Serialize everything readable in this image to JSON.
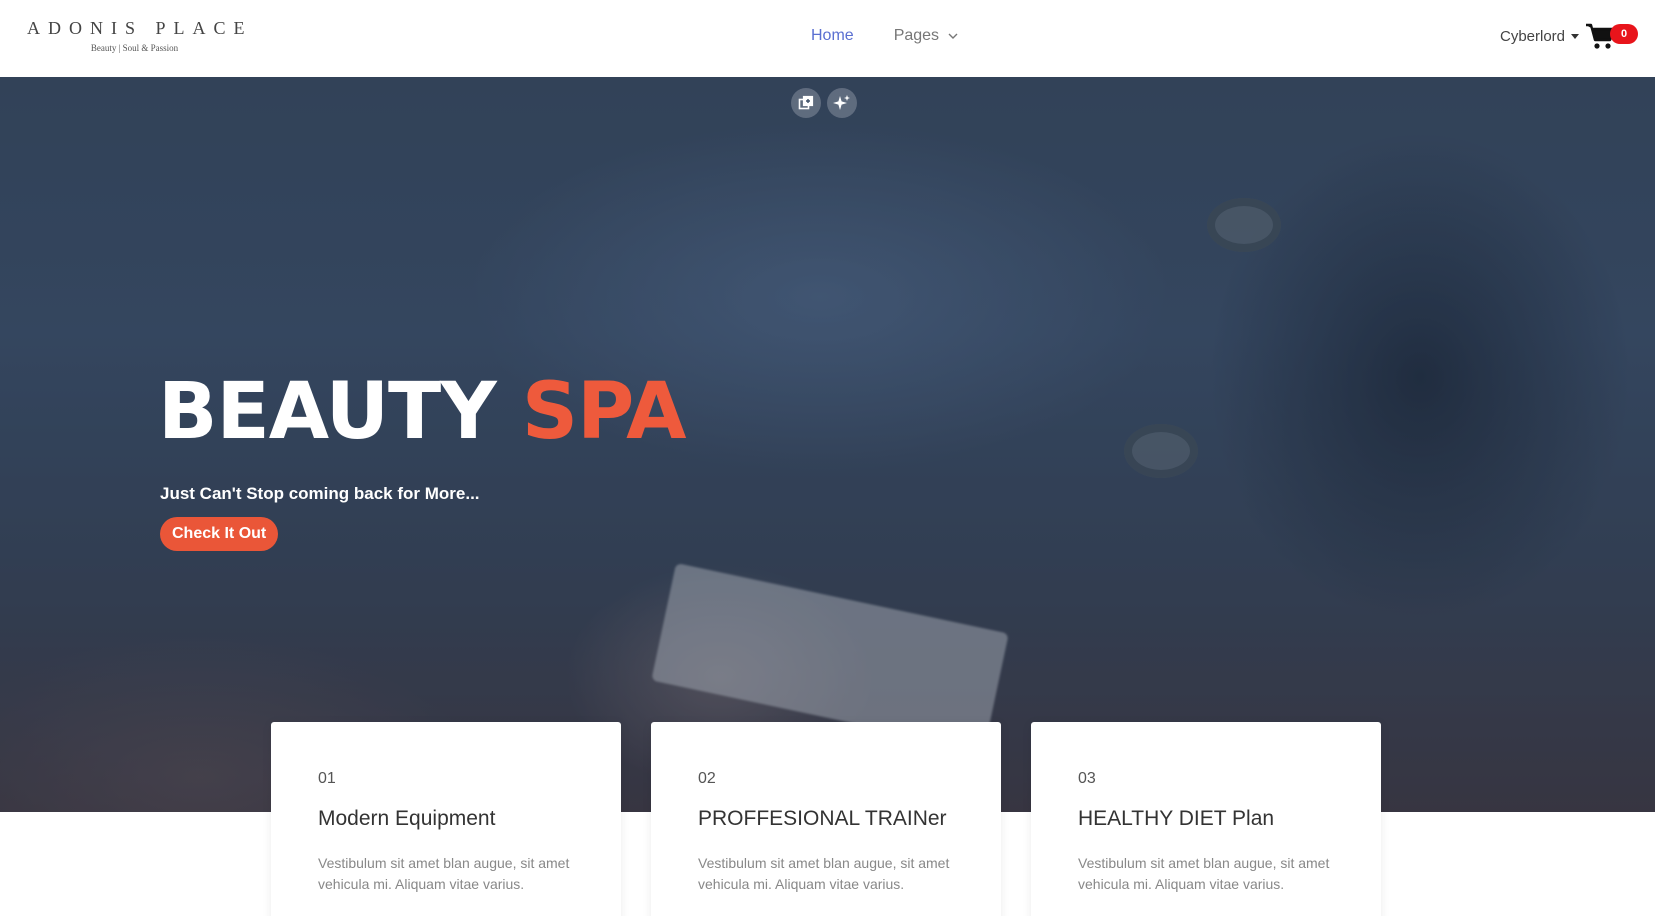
{
  "brand": {
    "name": "ADONIS PLACE",
    "tagline": "Beauty | Soul & Passion"
  },
  "nav": {
    "items": [
      {
        "label": "Home",
        "active": true
      },
      {
        "label": "Pages",
        "dropdown": true
      }
    ]
  },
  "user": {
    "name": "Cyberlord"
  },
  "cart": {
    "count": "0",
    "icon": "shopping-cart-icon"
  },
  "hero": {
    "title_main": "BEAUTY ",
    "title_accent": "SPA",
    "subtitle": "Just Can't Stop coming back for More...",
    "cta_label": "Check It Out",
    "tools": [
      "copy-image-icon",
      "sparkle-icon"
    ]
  },
  "colors": {
    "accent": "#ee5a3c",
    "nav_active": "#5a6fd1",
    "badge": "#e8141b"
  },
  "features": [
    {
      "number": "01",
      "title": "Modern Equipment",
      "text": "Vestibulum sit amet blan augue, sit amet vehicula mi. Aliquam vitae varius."
    },
    {
      "number": "02",
      "title": "PROFFESIONAL TRAINer",
      "text": "Vestibulum sit amet blan augue, sit amet vehicula mi. Aliquam vitae varius."
    },
    {
      "number": "03",
      "title": "HEALTHY DIET Plan",
      "text": "Vestibulum sit amet blan augue, sit amet vehicula mi. Aliquam vitae varius."
    }
  ]
}
